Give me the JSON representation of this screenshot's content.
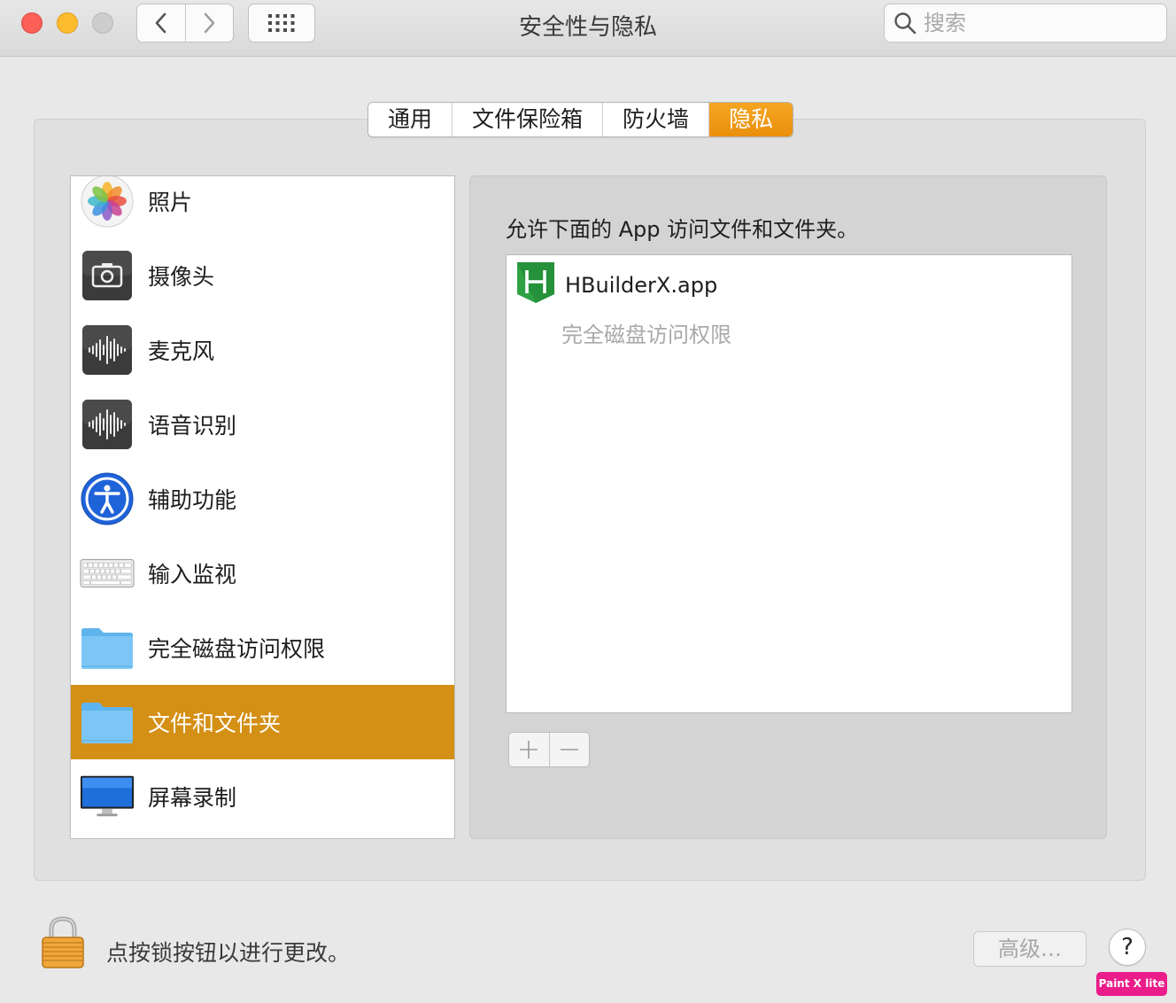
{
  "window": {
    "title": "安全性与隐私"
  },
  "search": {
    "placeholder": "搜索",
    "value": ""
  },
  "tabs": [
    {
      "label": "通用",
      "active": false
    },
    {
      "label": "文件保险箱",
      "active": false
    },
    {
      "label": "防火墙",
      "active": false
    },
    {
      "label": "隐私",
      "active": true
    }
  ],
  "sidebar": {
    "items": [
      {
        "label": "照片",
        "icon": "photos-icon"
      },
      {
        "label": "摄像头",
        "icon": "camera-icon"
      },
      {
        "label": "麦克风",
        "icon": "microphone-icon"
      },
      {
        "label": "语音识别",
        "icon": "speech-recognition-icon"
      },
      {
        "label": "辅助功能",
        "icon": "accessibility-icon"
      },
      {
        "label": "输入监视",
        "icon": "keyboard-icon"
      },
      {
        "label": "完全磁盘访问权限",
        "icon": "folder-icon"
      },
      {
        "label": "文件和文件夹",
        "icon": "folder-icon",
        "selected": true
      },
      {
        "label": "屏幕录制",
        "icon": "display-icon"
      }
    ]
  },
  "content": {
    "description": "允许下面的 App 访问文件和文件夹。",
    "apps": [
      {
        "name": "HBuilderX.app",
        "permission": "完全磁盘访问权限",
        "icon": "hbuilderx-icon"
      }
    ],
    "add_label": "+",
    "remove_label": "—"
  },
  "footer": {
    "lock_text": "点按锁按钮以进行更改。",
    "advanced_label": "高级…",
    "help_label": "?"
  },
  "watermark": "Paint X lite",
  "colors": {
    "accent": "#ea8f0c",
    "selection": "#d48f15",
    "close": "#fc5f57",
    "minimize": "#fdbc2e"
  }
}
